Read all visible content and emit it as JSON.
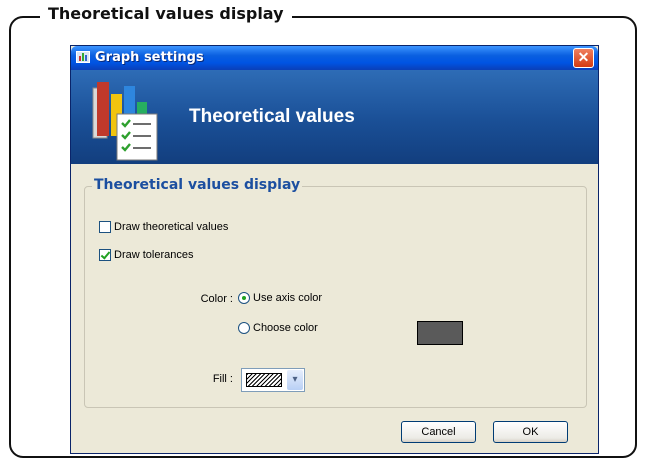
{
  "figure": {
    "frame_title": "Theoretical values display"
  },
  "window": {
    "title": "Graph settings",
    "close_glyph": "✕"
  },
  "banner": {
    "title": "Theoretical values",
    "icon": "chart-checklist-icon"
  },
  "section": {
    "legend": "Theoretical values display",
    "draw_theoretical": {
      "label": "Draw theoretical values",
      "checked": false
    },
    "draw_tolerances": {
      "label": "Draw tolerances",
      "checked": true
    },
    "color": {
      "label": "Color :",
      "option_axis": {
        "label": "Use axis color",
        "selected": true
      },
      "option_choose": {
        "label": "Choose color",
        "selected": false
      },
      "swatch_color": "#5a5a5a"
    },
    "fill": {
      "label": "Fill :",
      "pattern": "diagonal-hatch",
      "arrow_glyph": "▾"
    }
  },
  "buttons": {
    "cancel": "Cancel",
    "ok": "OK"
  },
  "colors": {
    "titlebar": "#0054e3",
    "banner": "#1a4f96",
    "legend_text": "#1c4fa0",
    "dialog_bg": "#ece9d8"
  }
}
